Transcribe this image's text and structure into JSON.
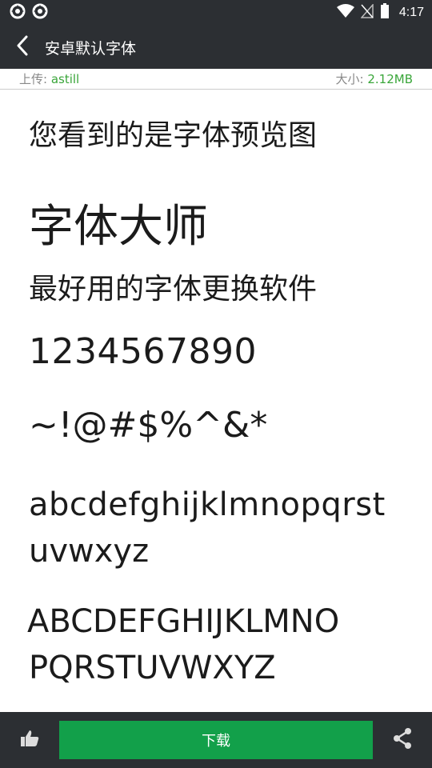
{
  "status_bar": {
    "time": "4:17",
    "icons": [
      "app-notification-icon",
      "app-notification-icon",
      "wifi-icon",
      "no-signal-icon",
      "battery-icon"
    ]
  },
  "toolbar": {
    "title": "安卓默认字体",
    "back_icon": "chevron-left-icon"
  },
  "info": {
    "uploader_label": "上传: ",
    "uploader": "astill",
    "size_label": "大小: ",
    "size": "2.12MB"
  },
  "preview": {
    "line1": "您看到的是字体预览图",
    "line2": "字体大师",
    "line3": "最好用的字体更换软件",
    "digits": "1234567890",
    "symbols": "~!@#$%^&*",
    "lower1": "abcdefghijklmnopqrst",
    "lower2": "uvwxyz",
    "upper1": "ABCDEFGHIJKLMNO",
    "upper2": "PQRSTUVWXYZ"
  },
  "bottom_bar": {
    "like_icon": "thumbs-up-icon",
    "download_label": "下载",
    "share_icon": "share-icon"
  },
  "colors": {
    "bar_background": "#2c2f33",
    "accent_green": "#12a04a",
    "info_green": "#3aa63a"
  }
}
